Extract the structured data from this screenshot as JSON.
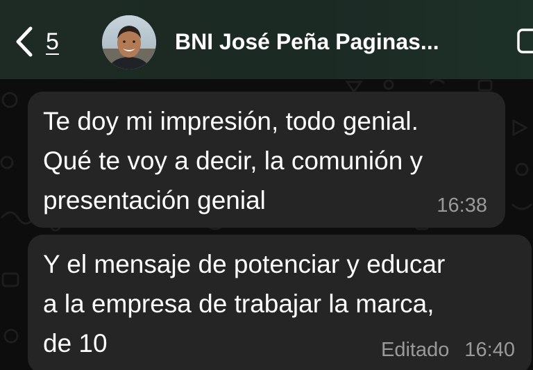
{
  "header": {
    "back_count": "5",
    "chat_title": "BNI José Peña Paginas..."
  },
  "messages": [
    {
      "lines": [
        "Te doy mi impresión, todo genial.",
        "Qué te voy a decir, la comunión y",
        "presentación genial"
      ],
      "time": "16:38"
    },
    {
      "lines": [
        "Y el mensaje de potenciar y educar",
        "a la empresa de trabajar la marca,",
        "de 10"
      ],
      "edited": "Editado",
      "time": "16:40"
    }
  ],
  "colors": {
    "header_bg": "#1e2b25",
    "bubble_bg": "#252525",
    "meta_text": "#9a9a9a"
  },
  "icons": [
    "chevron-left-icon",
    "video-call-icon"
  ]
}
